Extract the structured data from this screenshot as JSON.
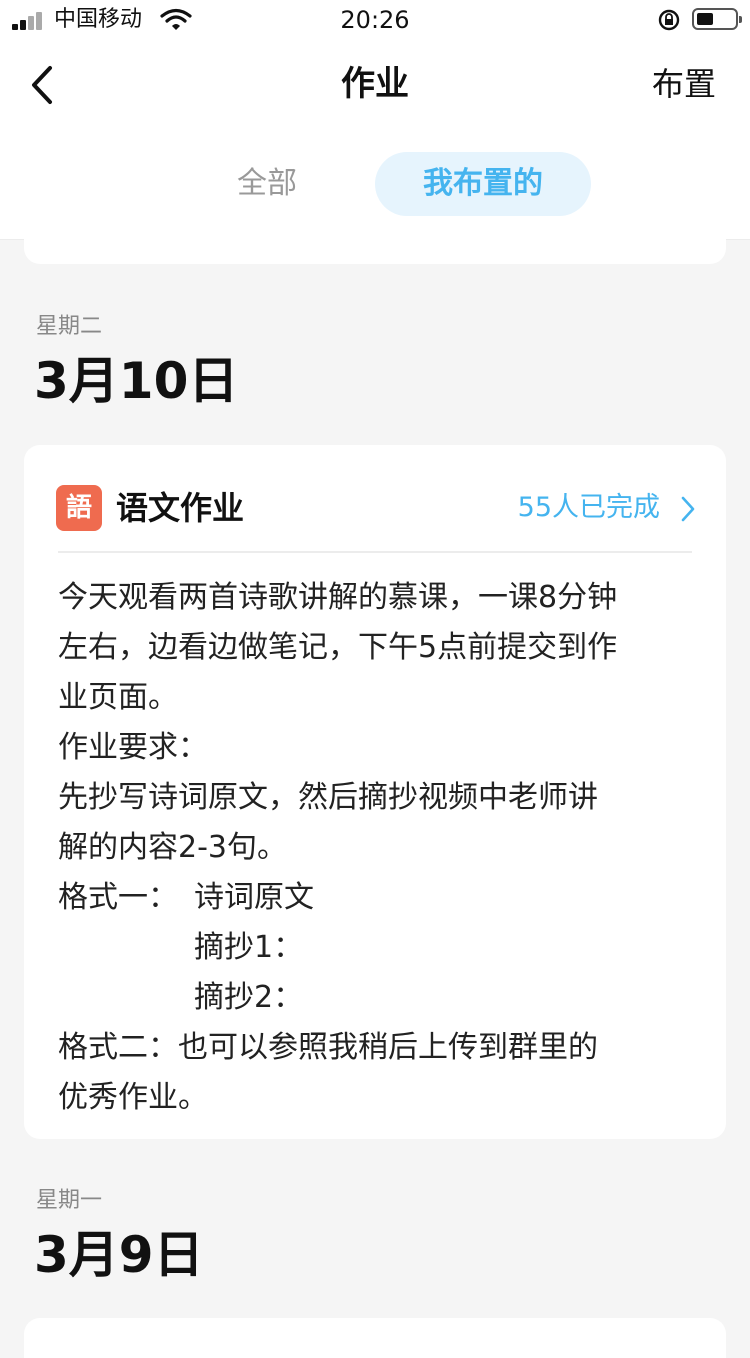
{
  "status_bar": {
    "carrier": "中国移动",
    "time": "20:26"
  },
  "nav": {
    "title": "作业",
    "action_label": "布置"
  },
  "tabs": [
    {
      "label": "全部",
      "active": false
    },
    {
      "label": "我布置的",
      "active": true
    }
  ],
  "sections": [
    {
      "weekday": "星期二",
      "date": "3月10日",
      "assignment": {
        "subject_badge": "語",
        "title": "语文作业",
        "completion": "55人已完成",
        "lines": [
          "今天观看两首诗歌讲解的慕课，一课8分钟",
          "左右，边看边做笔记，下午5点前提交到作",
          "业页面。",
          "作业要求：",
          "先抄写诗词原文，然后摘抄视频中老师讲",
          "解的内容2-3句。",
          "格式一：",
          "诗词原文",
          "摘抄1：",
          "摘抄2：",
          "格式二：也可以参照我稍后上传到群里的",
          "优秀作业。"
        ]
      }
    },
    {
      "weekday": "星期一",
      "date": "3月9日"
    }
  ],
  "colors": {
    "accent": "#45b4ef",
    "badge": "#ef6b4f",
    "background": "#f5f5f5"
  }
}
